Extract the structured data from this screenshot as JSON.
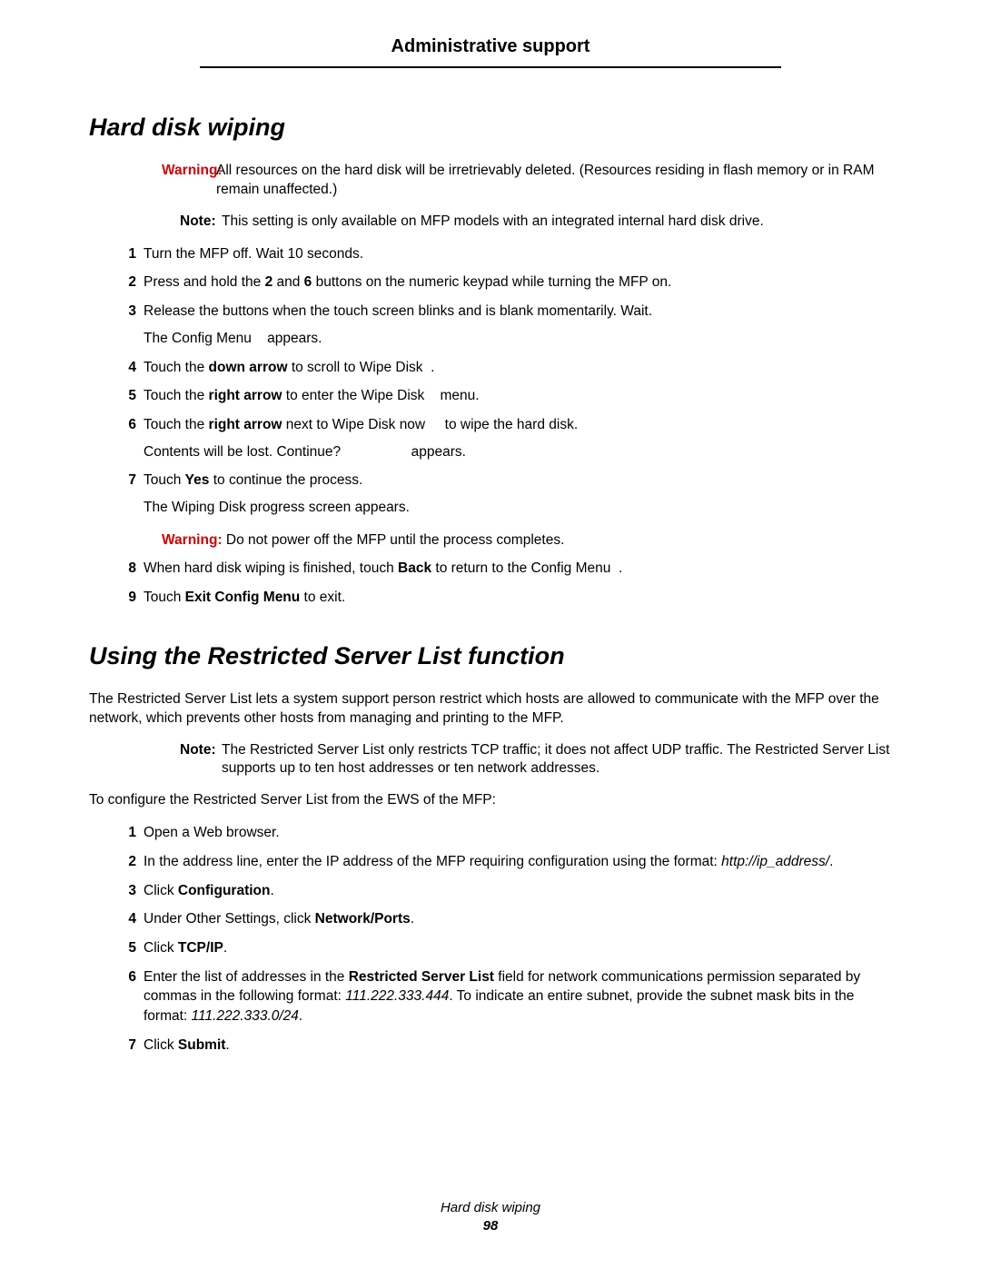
{
  "chapter": "Administrative support",
  "section1": {
    "title": "Hard disk wiping",
    "warning1": {
      "label": "Warning:",
      "text": "All resources on the hard disk will be irretrievably deleted. (Resources residing in flash memory or in RAM remain unaffected.)"
    },
    "note1": {
      "label": "Note:",
      "text": "This setting is only available on MFP models with an integrated internal hard disk drive."
    },
    "steps": [
      {
        "n": "1",
        "html": "Turn the MFP off. Wait 10 seconds."
      },
      {
        "n": "2",
        "html": "Press and hold the <b>2</b> and <b>6</b> buttons on the numeric keypad while turning the MFP on."
      },
      {
        "n": "3",
        "html": "Release the buttons when the touch screen blinks and is blank momentarily. Wait.",
        "sub": "The Config Menu&nbsp;&nbsp;&nbsp;&nbsp;appears."
      },
      {
        "n": "4",
        "html": "Touch the <b>down arrow</b> to scroll to Wipe Disk&nbsp;&nbsp;."
      },
      {
        "n": "5",
        "html": "Touch the <b>right arrow</b> to enter the Wipe Disk&nbsp;&nbsp;&nbsp;&nbsp;menu."
      },
      {
        "n": "6",
        "html": "Touch the <b>right arrow</b> next to Wipe Disk now&nbsp;&nbsp;&nbsp;&nbsp;&nbsp;to wipe the hard disk.",
        "sub": "Contents will be lost. Continue?&nbsp;&nbsp;&nbsp;&nbsp;&nbsp;&nbsp;&nbsp;&nbsp;&nbsp;&nbsp;&nbsp;&nbsp;&nbsp;&nbsp;&nbsp;&nbsp;&nbsp;&nbsp;appears."
      },
      {
        "n": "7",
        "html": "Touch <b>Yes</b> to continue the process.",
        "sub": "The Wiping Disk progress screen appears.",
        "inner_warn": {
          "label": "Warning:",
          "text": "Do not power off the MFP until the process completes."
        }
      },
      {
        "n": "8",
        "html": "When hard disk wiping is finished, touch <b>Back</b> to return to the Config Menu&nbsp;&nbsp;."
      },
      {
        "n": "9",
        "html": "Touch <b>Exit Config Menu</b> to exit."
      }
    ]
  },
  "section2": {
    "title": "Using the Restricted Server List function",
    "intro": "The Restricted Server List lets a system support person restrict which hosts are allowed to communicate with the MFP over the network, which prevents other hosts from managing and printing to the MFP.",
    "note1": {
      "label": "Note:",
      "text": "The Restricted Server List only restricts TCP traffic; it does not affect UDP traffic. The Restricted Server List supports up to ten host addresses or ten network addresses."
    },
    "lead": "To configure the Restricted Server List from the EWS of the MFP:",
    "steps": [
      {
        "n": "1",
        "html": "Open a Web browser."
      },
      {
        "n": "2",
        "html": "In the address line, enter the IP address of the MFP requiring configuration using the format: <i>http://ip_address/</i>."
      },
      {
        "n": "3",
        "html": "Click <b>Configuration</b>."
      },
      {
        "n": "4",
        "html": "Under Other Settings, click <b>Network/Ports</b>."
      },
      {
        "n": "5",
        "html": "Click <b>TCP/IP</b>."
      },
      {
        "n": "6",
        "html": "Enter the list of addresses in the <b>Restricted Server List</b> field for network communications permission separated by commas in the following format: <i>111.222.333.444</i>. To indicate an entire subnet, provide the subnet mask bits in the format: <i>111.222.333.0/24</i>."
      },
      {
        "n": "7",
        "html": "Click <b>Submit</b>."
      }
    ]
  },
  "footer": {
    "title": "Hard disk wiping",
    "page": "98"
  }
}
